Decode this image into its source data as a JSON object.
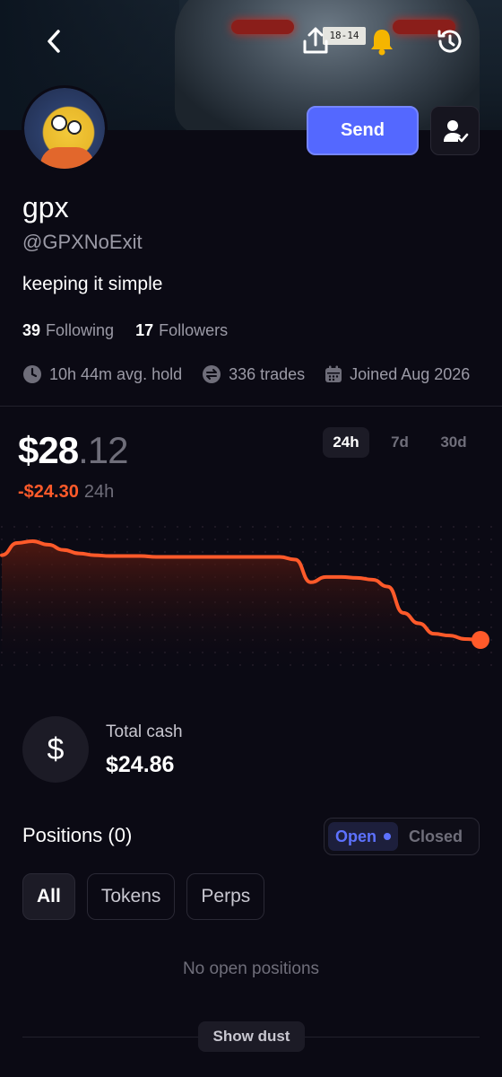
{
  "banner": {
    "plate_text": "18-14"
  },
  "header": {
    "send_label": "Send"
  },
  "profile": {
    "name": "gpx",
    "handle": "@GPXNoExit",
    "bio": "keeping it simple",
    "following_count": "39",
    "following_label": "Following",
    "followers_count": "17",
    "followers_label": "Followers",
    "avg_hold": "10h 44m avg. hold",
    "trades": "336 trades",
    "joined": "Joined Aug 2026"
  },
  "portfolio": {
    "balance_whole": "$28",
    "balance_cents": ".12",
    "change": "-$24.30",
    "change_period": "24h",
    "ranges": [
      "24h",
      "7d",
      "30d"
    ],
    "active_range": "24h"
  },
  "chart_data": {
    "type": "line",
    "title": "",
    "series": [
      {
        "values": [
          28.0,
          29.4,
          29.6,
          29.2,
          28.6,
          28.2,
          28.0,
          27.9,
          27.9,
          27.9,
          27.8,
          27.8,
          27.8,
          27.8,
          27.8,
          27.8,
          27.8,
          27.8,
          27.8,
          27.5,
          24.9,
          25.5,
          25.5,
          25.4,
          25.2,
          24.4,
          21.4,
          20.2,
          19.0,
          18.8,
          18.4,
          18.3
        ]
      }
    ],
    "color": "#ff5a2a",
    "grid": false
  },
  "cash": {
    "label": "Total cash",
    "value": "$24.86",
    "icon": "dollar-icon"
  },
  "positions": {
    "title": "Positions (0)",
    "open_label": "Open",
    "closed_label": "Closed",
    "filters": [
      "All",
      "Tokens",
      "Perps"
    ],
    "active_filter": "All",
    "empty_text": "No open positions",
    "dust_label": "Show dust"
  },
  "colors": {
    "accent": "#5468ff",
    "negative": "#ff5a2a",
    "background": "#0b0a14"
  }
}
